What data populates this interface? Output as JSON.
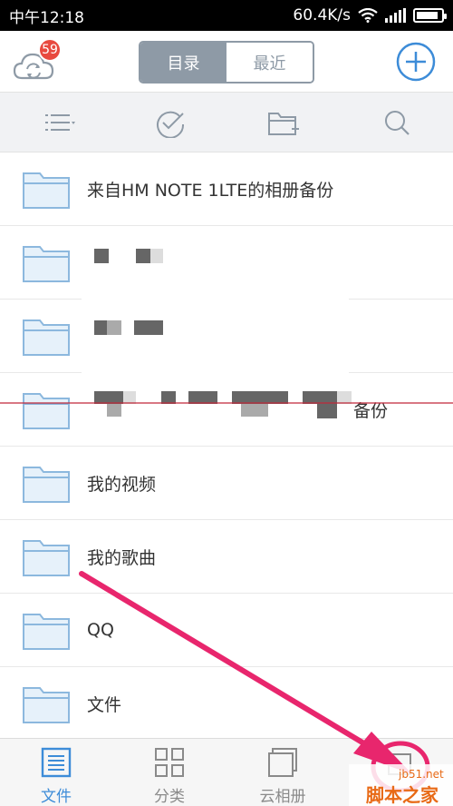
{
  "status_bar": {
    "time": "中午12:18",
    "speed": "60.4K/s"
  },
  "header": {
    "badge_count": "59",
    "tabs": [
      {
        "label": "目录",
        "active": true
      },
      {
        "label": "最近",
        "active": false
      }
    ],
    "accent": "#3d8cd8",
    "segment_color": "#8e9aa6"
  },
  "toolbar": {
    "icons": [
      "list-sort-icon",
      "check-circle-icon",
      "new-folder-icon",
      "search-icon"
    ]
  },
  "files": [
    {
      "label": "来自HM NOTE 1LTE的相册备份"
    },
    {
      "label": ""
    },
    {
      "label": ""
    },
    {
      "label": "备份"
    },
    {
      "label": "我的视频"
    },
    {
      "label": "我的歌曲"
    },
    {
      "label": "QQ"
    },
    {
      "label": "文件"
    }
  ],
  "tabbar": {
    "tabs": [
      {
        "label": "文件",
        "icon": "file-list-icon",
        "active": true
      },
      {
        "label": "分类",
        "icon": "grid-icon",
        "active": false
      },
      {
        "label": "云相册",
        "icon": "cloud-album-icon",
        "active": false
      }
    ]
  },
  "watermark": {
    "site": "jb51.net",
    "name": "脚本之家"
  }
}
